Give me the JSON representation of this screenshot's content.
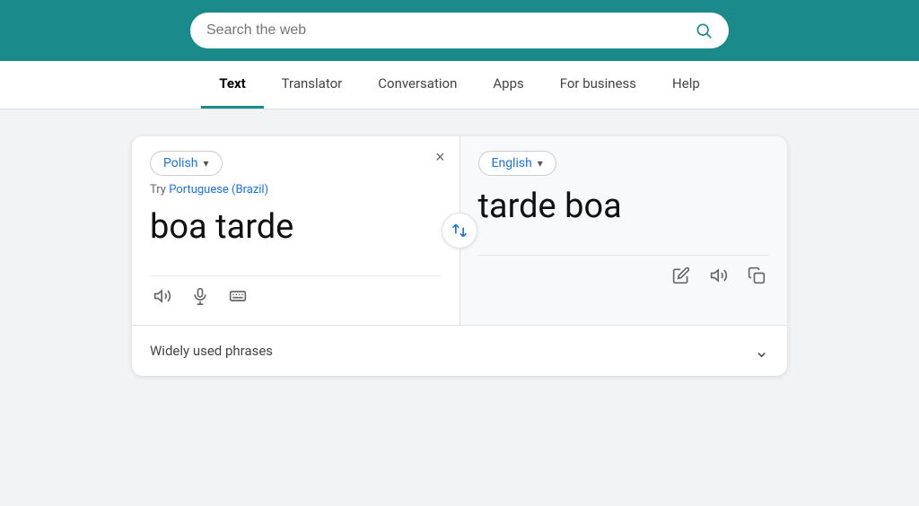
{
  "header": {
    "search_placeholder": "Search the web",
    "bg_color": "#1a8a8a"
  },
  "nav": {
    "items": [
      {
        "label": "Text",
        "active": true
      },
      {
        "label": "Translator",
        "active": false
      },
      {
        "label": "Conversation",
        "active": false
      },
      {
        "label": "Apps",
        "active": false
      },
      {
        "label": "For business",
        "active": false
      },
      {
        "label": "Help",
        "active": false
      }
    ]
  },
  "translator": {
    "source_lang": "Polish",
    "target_lang": "English",
    "try_label": "Try",
    "suggestion": "Portuguese (Brazil)",
    "source_text": "boa tarde",
    "target_text": "tarde boa",
    "clear_icon": "×",
    "swap_icon": "⇄",
    "phrases_label": "Widely used phrases",
    "actions": {
      "speaker_label": "speaker",
      "mic_label": "microphone",
      "keyboard_label": "keyboard"
    }
  }
}
